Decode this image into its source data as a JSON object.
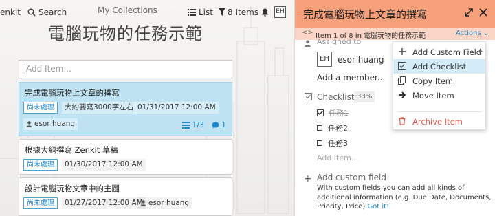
{
  "topbar": {
    "brand": "enkit",
    "search_label": "Search",
    "collection_title": "My Collections",
    "list_label": "List",
    "items_label": "8 Items",
    "avatar_initials": "EH"
  },
  "page": {
    "title": "電腦玩物的任務示範",
    "add_item_placeholder": "Add Item..."
  },
  "cards": [
    {
      "title": "完成電腦玩物上文章的撰寫",
      "status": "尚未處理",
      "note": "大約要寫3000字左右",
      "date": "01/31/2017 12:00 AM",
      "assignee": "esor huang",
      "checklist_count": "1/3",
      "comment_count": "1",
      "selected": true
    },
    {
      "title": "根據大綱撰寫 Zenkit 草稿",
      "status": "尚未處理",
      "date": "01/30/2017 12:00 AM",
      "selected": false
    },
    {
      "title": "設計電腦玩物文章中的主圖",
      "status": "尚未處理",
      "date": "01/27/2017 12:00 AM",
      "assignee": "esor huang",
      "selected": false
    }
  ],
  "detail": {
    "title": "完成電腦玩物上文章的撰寫",
    "breadcrumb": "Item 1 of 8 in 電腦玩物的任務示範",
    "actions_label": "Actions",
    "assigned_label": "Assigned to",
    "assignee_initials": "EH",
    "assignee_name": "esor huang",
    "add_member": "Add a member...",
    "checklist_label": "Checklist",
    "checklist_percent": "33%",
    "checklist_items": [
      {
        "label": "任務1",
        "done": true
      },
      {
        "label": "任務2",
        "done": false
      },
      {
        "label": "任務3",
        "done": false
      }
    ],
    "add_item": "Add Item...",
    "add_custom_field": "Add custom field",
    "custom_field_desc": "With custom fields you can add all kinds of additional information (e.g. Due Date, Documents, Priority, Price)",
    "got_it": "Got it!"
  },
  "actions_menu": {
    "items": [
      {
        "label": "Add Custom Field",
        "icon": "plus-icon"
      },
      {
        "label": "Add Checklist",
        "icon": "checklist-icon",
        "highlighted": true
      },
      {
        "label": "Copy Item",
        "icon": "copy-icon"
      },
      {
        "label": "Move Item",
        "icon": "arrow-right-icon"
      },
      {
        "label": "Archive Item",
        "icon": "trash-icon",
        "danger": true
      }
    ]
  },
  "colors": {
    "accent_blue": "#1e88c9",
    "selected_card": "#bfe3f3",
    "detail_header": "#f6a07b",
    "detail_subheader": "#fbd6c6",
    "menu_highlight": "#d3ecf8",
    "danger": "#e05a4e"
  }
}
